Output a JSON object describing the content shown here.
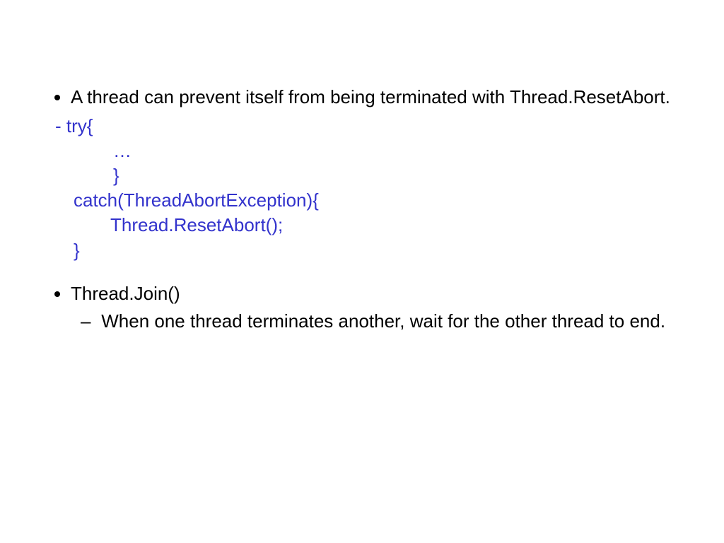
{
  "bullets": {
    "b1": "A thread can prevent itself from being terminated with Thread.ResetAbort.",
    "b2": "Thread.Join()",
    "b2sub": "When one thread terminates another, wait for the other thread to end."
  },
  "code": {
    "l1": "- try{",
    "l2": "…",
    "l3": "}",
    "l4": "catch(ThreadAbortException){",
    "l5": "Thread.ResetAbort();",
    "l6": "}"
  }
}
